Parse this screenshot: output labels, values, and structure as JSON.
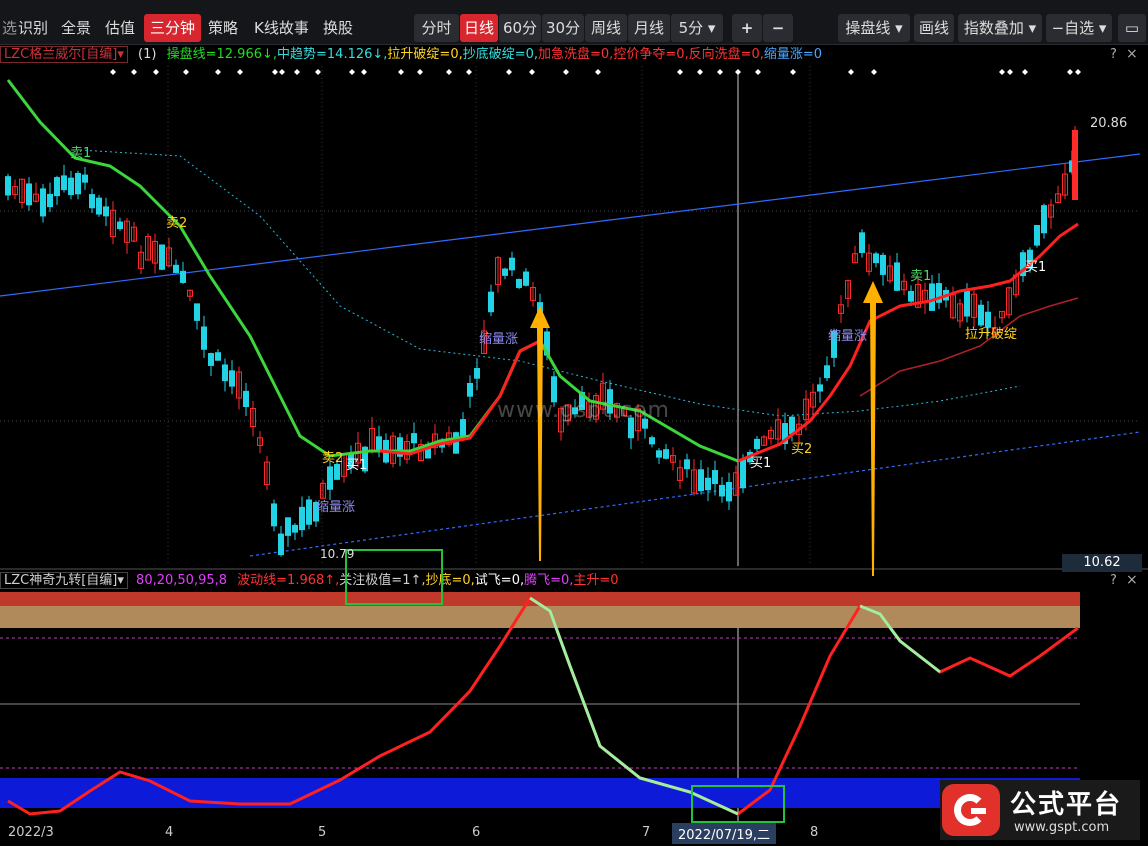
{
  "toolbar": {
    "left_items": [
      {
        "label": "识别"
      },
      {
        "label": "全景"
      },
      {
        "label": "估值"
      },
      {
        "label": "三分钟",
        "active": true
      },
      {
        "label": "策略"
      },
      {
        "label": "K线故事"
      },
      {
        "label": "换股"
      }
    ],
    "periods": [
      {
        "label": "分时"
      },
      {
        "label": "日线",
        "active": true
      },
      {
        "label": "60分"
      },
      {
        "label": "30分"
      },
      {
        "label": "周线"
      },
      {
        "label": "月线"
      },
      {
        "label": "5分 ▾"
      }
    ],
    "zoom_in": "+",
    "zoom_out": "−",
    "right_items": [
      {
        "label": "操盘线 ▾"
      },
      {
        "label": "画线"
      },
      {
        "label": "指数叠加 ▾"
      },
      {
        "label": "−自选 ▾"
      }
    ]
  },
  "main_indicator": {
    "name": "LZC格兰威尔[自编]",
    "param": "(1)",
    "values": [
      {
        "text": "操盘线=12.966↓",
        "color": "#22dd22"
      },
      {
        "text": "中趋势=14.126↓",
        "color": "#33dddd"
      },
      {
        "text": "拉升破绽=0",
        "color": "#ffd21f"
      },
      {
        "text": "抄底破绽=0",
        "color": "#33dddd"
      },
      {
        "text": "加急洗盘=0",
        "color": "#ff3333"
      },
      {
        "text": "控价争夺=0",
        "color": "#ff3333"
      },
      {
        "text": "反向洗盘=0",
        "color": "#ff3333"
      },
      {
        "text": "缩量涨=0",
        "color": "#4da6ff"
      }
    ]
  },
  "price_labels": {
    "high": "20.86",
    "low": "10.79",
    "current": "10.62"
  },
  "chart_annotations": [
    {
      "text": "卖1",
      "color": "#4cd964"
    },
    {
      "text": "卖2",
      "color": "#ffd21f"
    },
    {
      "text": "缩量涨",
      "color": "#8e8cf0"
    },
    {
      "text": "卖2",
      "color": "#ffd21f"
    },
    {
      "text": "买1",
      "color": "#ffffff"
    },
    {
      "text": "缩量涨",
      "color": "#8e8cf0"
    },
    {
      "text": "买1",
      "color": "#ffffff"
    },
    {
      "text": "买2",
      "color": "#ffd21f"
    },
    {
      "text": "缩量涨",
      "color": "#8e8cf0"
    },
    {
      "text": "卖1",
      "color": "#4cd964"
    },
    {
      "text": "拉升破绽",
      "color": "#ffd21f"
    },
    {
      "text": "买1",
      "color": "#ffffff"
    }
  ],
  "watermark": "www.gspt.com",
  "sub_indicator": {
    "name": "LZC神奇九转[自编]",
    "params": "80,20,50,95,8",
    "values": [
      {
        "text": "波动线=1.968↑",
        "color": "#ff3333"
      },
      {
        "text": "关注极值=1↑",
        "color": "#cfcfcf"
      },
      {
        "text": "抄底=0",
        "color": "#ffd21f"
      },
      {
        "text": "试飞=0",
        "color": "#ffffff"
      },
      {
        "text": "腾飞=0",
        "color": "#e040fb"
      },
      {
        "text": "主升=0",
        "color": "#ff3333"
      }
    ]
  },
  "x_axis": {
    "ticks": [
      "2022/3",
      "4",
      "5",
      "6",
      "7",
      "8"
    ],
    "crosshair_date": "2022/07/19,二"
  },
  "close_icons": [
    "?",
    "×"
  ],
  "brand": {
    "name": "公式平台",
    "url": "www.gspt.com",
    "icon_color": "#e2312b"
  },
  "colors": {
    "up": "#ff2a2a",
    "down": "#22d3e6",
    "ma_green": "#3bd63b",
    "ma_red": "#ff2020",
    "trend_blue": "#2f6bff",
    "arrow": "#ffb000"
  }
}
